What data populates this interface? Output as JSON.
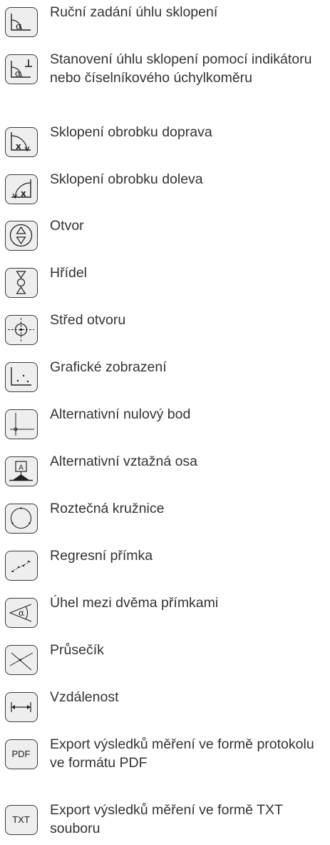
{
  "items": [
    {
      "icon": "manual-tilt-angle-icon",
      "label": "Ruční zadání úhlu sklopení"
    },
    {
      "icon": "tilt-angle-indicator-icon",
      "label": "Stanovení úhlu sklopení pomocí indikátoru nebo číselníkového úchyl­koměru"
    },
    {
      "icon": "tilt-right-icon",
      "label": "Sklopení obrobku doprava"
    },
    {
      "icon": "tilt-left-icon",
      "label": "Sklopení obrobku doleva"
    },
    {
      "icon": "bore-icon",
      "label": "Otvor"
    },
    {
      "icon": "shaft-icon",
      "label": "Hřídel"
    },
    {
      "icon": "bore-center-icon",
      "label": "Střed otvoru"
    },
    {
      "icon": "graphic-display-icon",
      "label": "Grafické zobrazení"
    },
    {
      "icon": "alternative-zero-point-icon",
      "label": "Alternativní nulový bod"
    },
    {
      "icon": "alternative-reference-axis-icon",
      "label": "Alternativní vztažná osa"
    },
    {
      "icon": "pitch-circle-icon",
      "label": "Roztečná kružnice"
    },
    {
      "icon": "regression-line-icon",
      "label": "Regresní přímka"
    },
    {
      "icon": "angle-between-lines-icon",
      "label": "Úhel mezi dvěma přímkami"
    },
    {
      "icon": "intersection-icon",
      "label": "Průsečík"
    },
    {
      "icon": "distance-icon",
      "label": "Vzdálenost"
    },
    {
      "icon": "export-pdf-icon",
      "label": "Export výsledků měření ve formě protokolu ve formátu PDF",
      "icon_text": "PDF"
    },
    {
      "icon": "export-txt-icon",
      "label": "Export výsledků měření ve formě TXT souboru",
      "icon_text": "TXT"
    }
  ]
}
